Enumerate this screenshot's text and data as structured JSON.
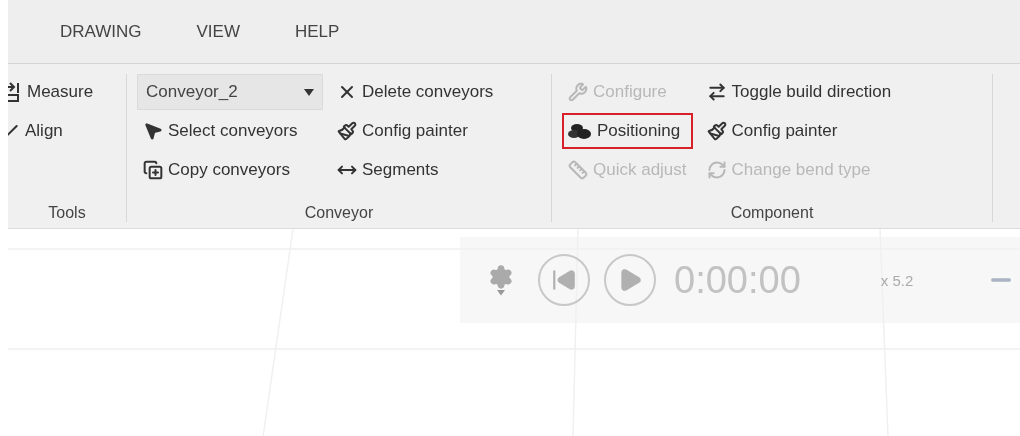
{
  "menu": {
    "items": [
      {
        "label": "DRAWING"
      },
      {
        "label": "VIEW"
      },
      {
        "label": "HELP"
      }
    ]
  },
  "ribbon": {
    "groups": [
      {
        "label": "Tools",
        "columns": [
          [
            {
              "kind": "button",
              "label": "Measure",
              "disabled": false,
              "highlighted": false
            },
            {
              "kind": "button",
              "label": "Align",
              "disabled": false,
              "highlighted": false
            }
          ]
        ]
      },
      {
        "label": "Conveyor",
        "columns": [
          [
            {
              "kind": "dropdown",
              "label": "Conveyor_2"
            },
            {
              "kind": "button",
              "label": "Select conveyors",
              "disabled": false,
              "highlighted": false
            },
            {
              "kind": "button",
              "label": "Copy conveyors",
              "disabled": false,
              "highlighted": false
            }
          ],
          [
            {
              "kind": "button",
              "label": "Delete conveyors",
              "disabled": false,
              "highlighted": false
            },
            {
              "kind": "button",
              "label": "Config painter",
              "disabled": false,
              "highlighted": false
            },
            {
              "kind": "button",
              "label": "Segments",
              "disabled": false,
              "highlighted": false
            }
          ]
        ]
      },
      {
        "label": "Component",
        "columns": [
          [
            {
              "kind": "button",
              "label": "Configure",
              "disabled": true,
              "highlighted": false
            },
            {
              "kind": "button",
              "label": "Positioning",
              "disabled": false,
              "highlighted": true
            },
            {
              "kind": "button",
              "label": "Quick adjust",
              "disabled": true,
              "highlighted": false
            }
          ],
          [
            {
              "kind": "button",
              "label": "Toggle build direction",
              "disabled": false,
              "highlighted": false
            },
            {
              "kind": "button",
              "label": "Config painter",
              "disabled": false,
              "highlighted": false
            },
            {
              "kind": "button",
              "label": "Change bend type",
              "disabled": true,
              "highlighted": false
            }
          ]
        ]
      }
    ]
  },
  "playback": {
    "time": "0:00:00",
    "speed": "x 5.2"
  }
}
